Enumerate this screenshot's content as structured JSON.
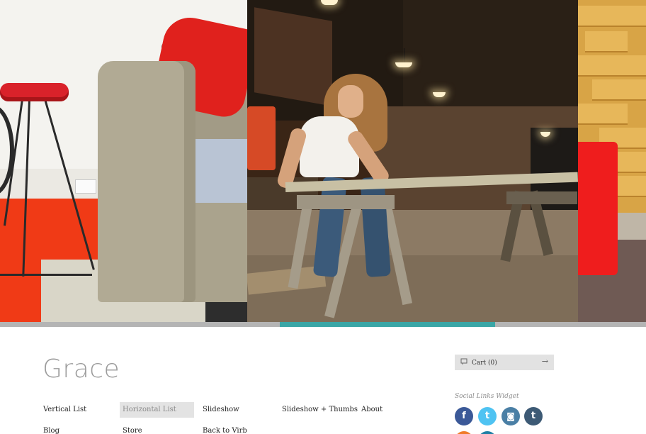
{
  "hero": {
    "panels": [
      "living-room-photo",
      "workshop-photo",
      "wood-wall-photo"
    ]
  },
  "slideshow": {
    "progress_fraction": 0.333,
    "track_color": "#b4b4b4",
    "fill_color": "#3aa6a6"
  },
  "site": {
    "logo_text": "Grace"
  },
  "nav": {
    "items": [
      {
        "label": "Vertical List"
      },
      {
        "label": "Horizontal List",
        "active": true
      },
      {
        "label": "Slideshow"
      },
      {
        "label": "Slideshow + Thumbs"
      },
      {
        "label": "About"
      },
      {
        "label": "Blog"
      },
      {
        "label": "Store"
      },
      {
        "label": "Back to Virb"
      }
    ]
  },
  "cart": {
    "label": "Cart (0)",
    "icon": "cart-icon",
    "arrow_icon": "arrow-right-icon",
    "arrow_glyph": "→"
  },
  "social": {
    "title": "Social Links Widget",
    "links": [
      {
        "icon": "facebook-icon",
        "glyph": "f",
        "color": "#3b5998"
      },
      {
        "icon": "twitter-icon",
        "glyph": "t",
        "color": "#4fc3f2"
      },
      {
        "icon": "instagram-icon",
        "glyph": "◙",
        "color": "#4a7fa5"
      },
      {
        "icon": "tumblr-icon",
        "glyph": "t",
        "color": "#3d5a75"
      }
    ]
  }
}
